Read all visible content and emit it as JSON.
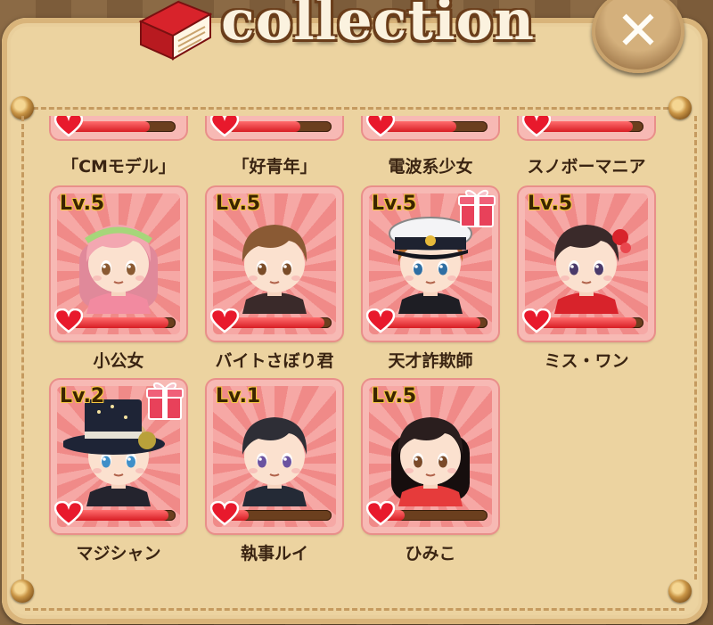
{
  "header": {
    "title": "collection",
    "close_label": "✕"
  },
  "top_row": [
    {
      "name": "「CMモデル」",
      "affection": 0.75
    },
    {
      "name": "「好青年」",
      "affection": 0.7
    },
    {
      "name": "電波系少女",
      "affection": 0.7
    },
    {
      "name": "スノボーマニア",
      "affection": 0.9
    }
  ],
  "cards": [
    {
      "level": "Lv.5",
      "name": "小公女",
      "affection": 0.93,
      "gift": false,
      "hair": "#f3a7b1",
      "hair_dark": "#e0899a",
      "eye": "#8a5a32",
      "outfit": "#f28aa0",
      "accessory": "headband"
    },
    {
      "level": "Lv.5",
      "name": "バイトさぼり君",
      "affection": 0.93,
      "gift": false,
      "hair": "#8a5a34",
      "hair_dark": "#6b4224",
      "eye": "#7a4c28",
      "outfit": "#3a2a2a",
      "accessory": "none"
    },
    {
      "level": "Lv.5",
      "name": "天才詐欺師",
      "affection": 0.93,
      "gift": true,
      "hair": "#b46a2a",
      "hair_dark": "#8f4f1c",
      "eye": "#2e6ea3",
      "outfit": "#1e1e24",
      "accessory": "captain-hat"
    },
    {
      "level": "Lv.5",
      "name": "ミス・ワン",
      "affection": 0.93,
      "gift": false,
      "hair": "#3a2a2a",
      "hair_dark": "#241818",
      "eye": "#4a3a6a",
      "outfit": "#d8232b",
      "accessory": "hair-ornament"
    },
    {
      "level": "Lv.2",
      "name": "マジシャン",
      "affection": 0.93,
      "gift": true,
      "hair": "#d8b07a",
      "hair_dark": "#b58e58",
      "eye": "#3f8fc8",
      "outfit": "#24242e",
      "accessory": "magician-hat"
    },
    {
      "level": "Lv.1",
      "name": "執事ルイ",
      "affection": 0.2,
      "gift": false,
      "hair": "#2e2e36",
      "hair_dark": "#1b1b22",
      "eye": "#6a52a0",
      "outfit": "#242a36",
      "accessory": "none"
    },
    {
      "level": "Lv.5",
      "name": "ひみこ",
      "affection": 0.2,
      "gift": false,
      "hair": "#2a1e1e",
      "hair_dark": "#160e0e",
      "eye": "#7a4a28",
      "outfit": "#e63b3b",
      "accessory": "none"
    }
  ]
}
